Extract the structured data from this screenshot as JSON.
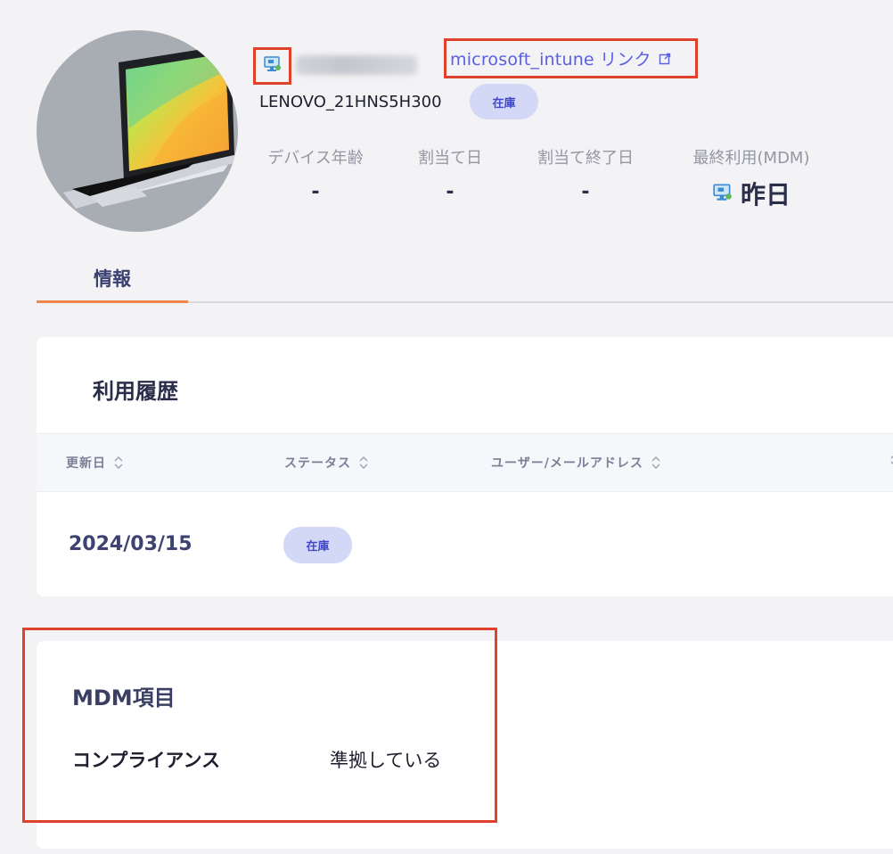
{
  "device": {
    "model": "LENOVO_21HNS5H300",
    "status_badge": "在庫",
    "intune_link_label": "microsoft_intune リンク",
    "mdm_icon": "managed-device-icon",
    "link_icon": "external-link-icon"
  },
  "stats": [
    {
      "label": "デバイス年齢",
      "value": "-"
    },
    {
      "label": "割当て日",
      "value": "-"
    },
    {
      "label": "割当て終了日",
      "value": "-"
    },
    {
      "label": "最終利用(MDM)",
      "value": "昨日"
    }
  ],
  "tabs": [
    {
      "label": "情報",
      "active": true
    }
  ],
  "history": {
    "title": "利用履歴",
    "columns": [
      "更新日",
      "ステータス",
      "ユーザー/メールアドレス"
    ],
    "rows": [
      {
        "date": "2024/03/15",
        "status": "在庫",
        "user": ""
      }
    ]
  },
  "mdm": {
    "title": "MDM項目",
    "items": [
      {
        "label": "コンプライアンス",
        "value": "準拠している"
      }
    ]
  },
  "colors": {
    "highlight": "#e0412b",
    "link": "#5a5fe0",
    "pill_bg": "#d4d8f7",
    "pill_text": "#4148c8",
    "tab_underline": "#f0864a"
  }
}
